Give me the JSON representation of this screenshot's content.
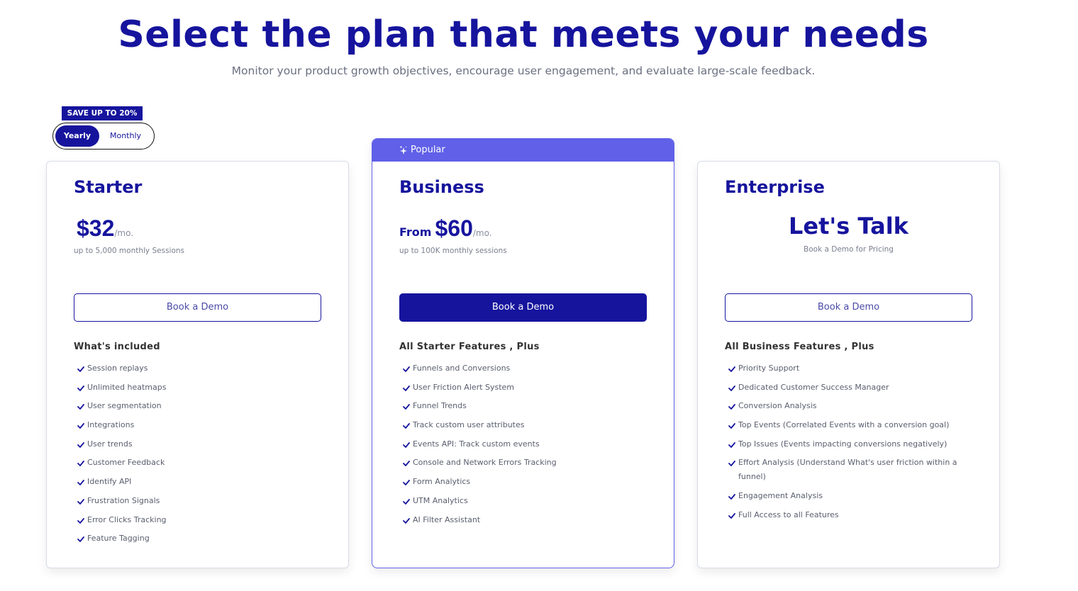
{
  "header": {
    "title": "Select the plan that meets your needs",
    "subtitle": "Monitor your product growth objectives, encourage user engagement, and evaluate large-scale feedback."
  },
  "billing": {
    "badge": "SAVE UP TO 20%",
    "options": [
      {
        "label": "Yearly",
        "selected": true
      },
      {
        "label": "Monthly",
        "selected": false
      }
    ]
  },
  "colors": {
    "brand": "#16149d",
    "popular": "#6060e8"
  },
  "plans": [
    {
      "name": "Starter",
      "price": "$32",
      "unit": "/mo.",
      "note": "up to 5,000 monthly Sessions",
      "cta": "Book a Demo",
      "features_heading": "What's included",
      "features": [
        "Session replays",
        "Unlimited heatmaps",
        "User segmentation",
        "Integrations",
        "User trends",
        "Customer Feedback",
        "Identify API",
        "Frustration Signals",
        "Error Clicks Tracking",
        "Feature Tagging"
      ]
    },
    {
      "name": "Business",
      "badge": "Popular",
      "badge_icon": "sparkle-icon",
      "price_prefix": "From",
      "price": "$60",
      "unit": "/mo.",
      "note": "up to 100K monthly sessions",
      "cta": "Book a Demo",
      "features_heading": "All Starter Features , Plus",
      "features": [
        "Funnels and Conversions",
        "User Friction Alert System",
        "Funnel Trends",
        "Track custom user attributes",
        "Events API: Track custom events",
        "Console and Network Errors Tracking",
        "Form Analytics",
        "UTM Analytics",
        "AI Filter Assistant"
      ]
    },
    {
      "name": "Enterprise",
      "price_text": "Let's Talk",
      "note": "Book a Demo for Pricing",
      "cta": "Book a Demo",
      "features_heading": "All Business Features , Plus",
      "features": [
        "Priority Support",
        "Dedicated Customer Success Manager",
        "Conversion Analysis",
        "Top Events (Correlated Events with a conversion goal)",
        "Top Issues (Events impacting conversions negatively)",
        "Effort Analysis (Understand What's user friction within a funnel)",
        "Engagement Analysis",
        "Full Access to all Features"
      ]
    }
  ]
}
